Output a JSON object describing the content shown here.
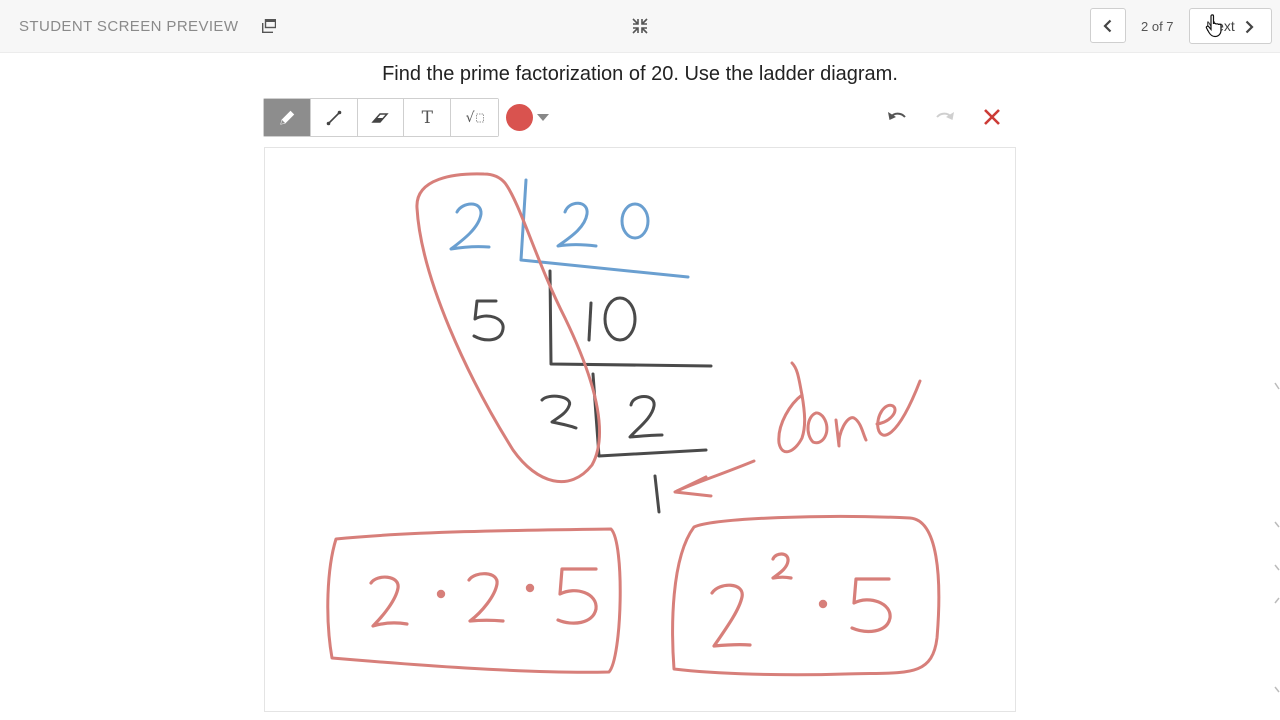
{
  "header": {
    "preview_label": "STUDENT SCREEN PREVIEW",
    "page_indicator": "2 of 7",
    "next_label": "Next"
  },
  "question": {
    "text": "Find the prime factorization of 20. Use the ladder diagram."
  },
  "toolbar": {
    "tools": [
      "pencil",
      "line",
      "eraser",
      "text",
      "math"
    ],
    "active_tool": "pencil",
    "text_tool_glyph": "T",
    "math_tool_glyph": "√",
    "selected_color": "#d9534f"
  },
  "colors": {
    "blue_ink": "#6a9fd0",
    "dark_ink": "#4a4a4a",
    "red_ink": "#d77f7a",
    "clear_icon": "#cc3b36"
  },
  "drawing": {
    "ladder_row1": [
      "2",
      "20"
    ],
    "ladder_row2": [
      "5",
      "10"
    ],
    "ladder_row3": [
      "2",
      "2"
    ],
    "ladder_result": "1",
    "annotation": "done",
    "answer_expanded": "2·2·5",
    "answer_exponent": "2²·5"
  }
}
